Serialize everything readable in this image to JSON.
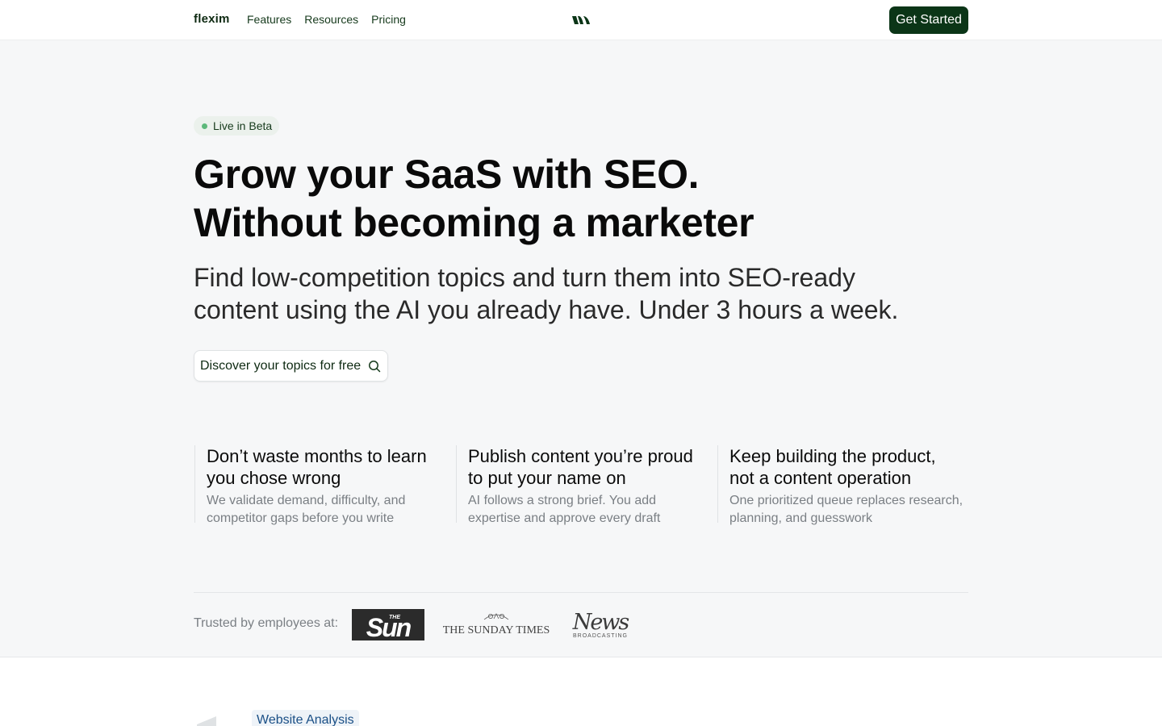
{
  "header": {
    "brand": "flexim",
    "nav": [
      "Features",
      "Resources",
      "Pricing"
    ],
    "cta_label": "Get Started"
  },
  "hero": {
    "badge": "Live in Beta",
    "title_lines": [
      "Grow your SaaS with SEO.",
      "Without becoming a marketer"
    ],
    "subtitle_lines": [
      "Find low-competition topics and turn them into SEO-ready",
      "content using the AI you already have. Under 3 hours a week."
    ],
    "button_label": "Discover your topics for free"
  },
  "features": [
    {
      "title_lines": [
        "Don’t waste months to learn",
        "you chose wrong"
      ],
      "desc_lines": [
        "We validate demand, difficulty, and",
        "competitor gaps before you write"
      ]
    },
    {
      "title_lines": [
        "Publish content you’re proud",
        "to put your name on"
      ],
      "desc_lines": [
        "AI follows a strong brief. You add",
        "expertise and approve every draft"
      ]
    },
    {
      "title_lines": [
        "Keep building the product,",
        "not a content operation"
      ],
      "desc_lines": [
        "One prioritized queue replaces research,",
        "planning, and guesswork"
      ]
    }
  ],
  "trusted": {
    "label": "Trusted by employees at:",
    "logos": [
      {
        "name": "The Sun",
        "lettering_small": "THE",
        "lettering": "Sun"
      },
      {
        "name": "The Sunday Times",
        "lettering": "THE SUNDAY TIMES"
      },
      {
        "name": "News Broadcasting",
        "lettering": "News",
        "lettering_small": "BROADCASTING"
      }
    ]
  },
  "lower": {
    "tag": "Website Analysis"
  },
  "colors": {
    "brand_dark": "#0b3517",
    "badge_dot": "#5cb87a",
    "page_bg": "#f6f7f8",
    "link_blue": "#1a4f86"
  },
  "icons": [
    "brand-mark-icon",
    "search-icon"
  ]
}
